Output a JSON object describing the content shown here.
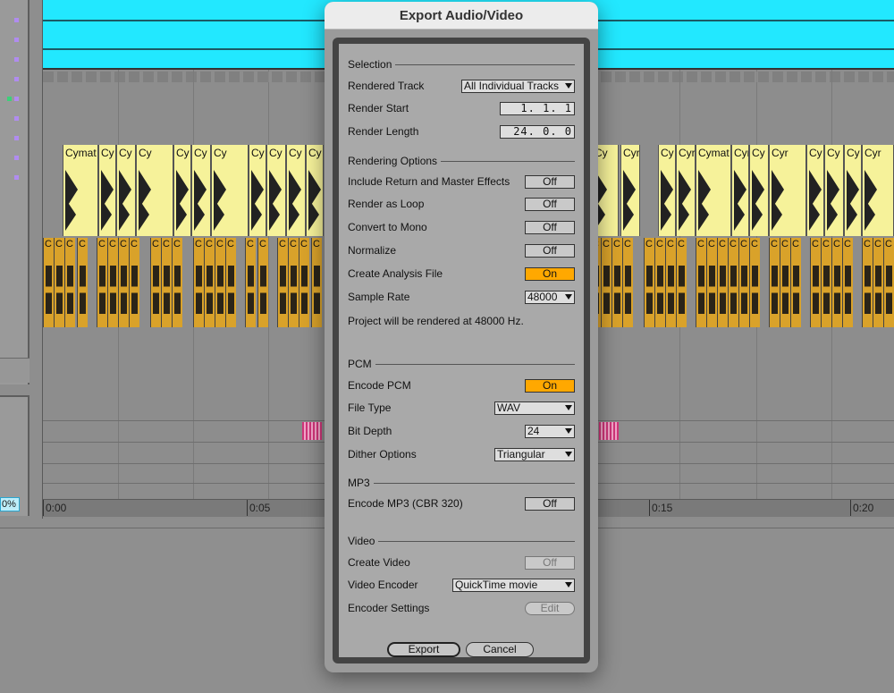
{
  "background": {
    "yellow_clip_labels": [
      "Cymat",
      "Cy",
      "Cy",
      "Cy",
      "Cy",
      "Cy",
      "Cy",
      "Cy",
      "Cy",
      "Cy",
      "Cy",
      "Cy",
      "Cyr",
      "Cy",
      "Cyr",
      "Cymat",
      "Cyr",
      "Cy",
      "Cyr",
      "Cy",
      "Cy",
      "Cy",
      "Cyr",
      "Cy",
      "Cyr",
      "Cy",
      "Cyr"
    ],
    "orange_clip_label": "C",
    "timeline": [
      "0:00",
      "0:05",
      "0:15",
      "0:20"
    ],
    "zoom_percent": "0%"
  },
  "dialog": {
    "title": "Export Audio/Video",
    "sections": {
      "selection": "Selection",
      "rendering": "Rendering Options",
      "pcm": "PCM",
      "mp3": "MP3",
      "video": "Video"
    },
    "rendered_track": {
      "label": "Rendered Track",
      "value": "All Individual Tracks"
    },
    "render_start": {
      "label": "Render Start",
      "value": "1.  1.  1"
    },
    "render_length": {
      "label": "Render Length",
      "value": "24.  0.  0"
    },
    "include_return": {
      "label": "Include Return and Master Effects",
      "value": "Off"
    },
    "render_loop": {
      "label": "Render as Loop",
      "value": "Off"
    },
    "convert_mono": {
      "label": "Convert to Mono",
      "value": "Off"
    },
    "normalize": {
      "label": "Normalize",
      "value": "Off"
    },
    "analysis_file": {
      "label": "Create Analysis File",
      "value": "On"
    },
    "sample_rate": {
      "label": "Sample Rate",
      "value": "48000"
    },
    "render_info": "Project will be rendered at 48000 Hz.",
    "encode_pcm": {
      "label": "Encode PCM",
      "value": "On"
    },
    "file_type": {
      "label": "File Type",
      "value": "WAV"
    },
    "bit_depth": {
      "label": "Bit Depth",
      "value": "24"
    },
    "dither": {
      "label": "Dither Options",
      "value": "Triangular"
    },
    "encode_mp3": {
      "label": "Encode MP3 (CBR 320)",
      "value": "Off"
    },
    "create_video": {
      "label": "Create Video",
      "value": "Off"
    },
    "video_encoder": {
      "label": "Video Encoder",
      "value": "QuickTime movie"
    },
    "encoder_settings": {
      "label": "Encoder Settings",
      "value": "Edit"
    },
    "export_button": "Export",
    "cancel_button": "Cancel"
  },
  "colors": {
    "toggle_on": "#ffa800",
    "cyan_clip": "#22e8ff",
    "yellow_clip": "#f6f29a",
    "orange_clip": "#d9a22a"
  }
}
